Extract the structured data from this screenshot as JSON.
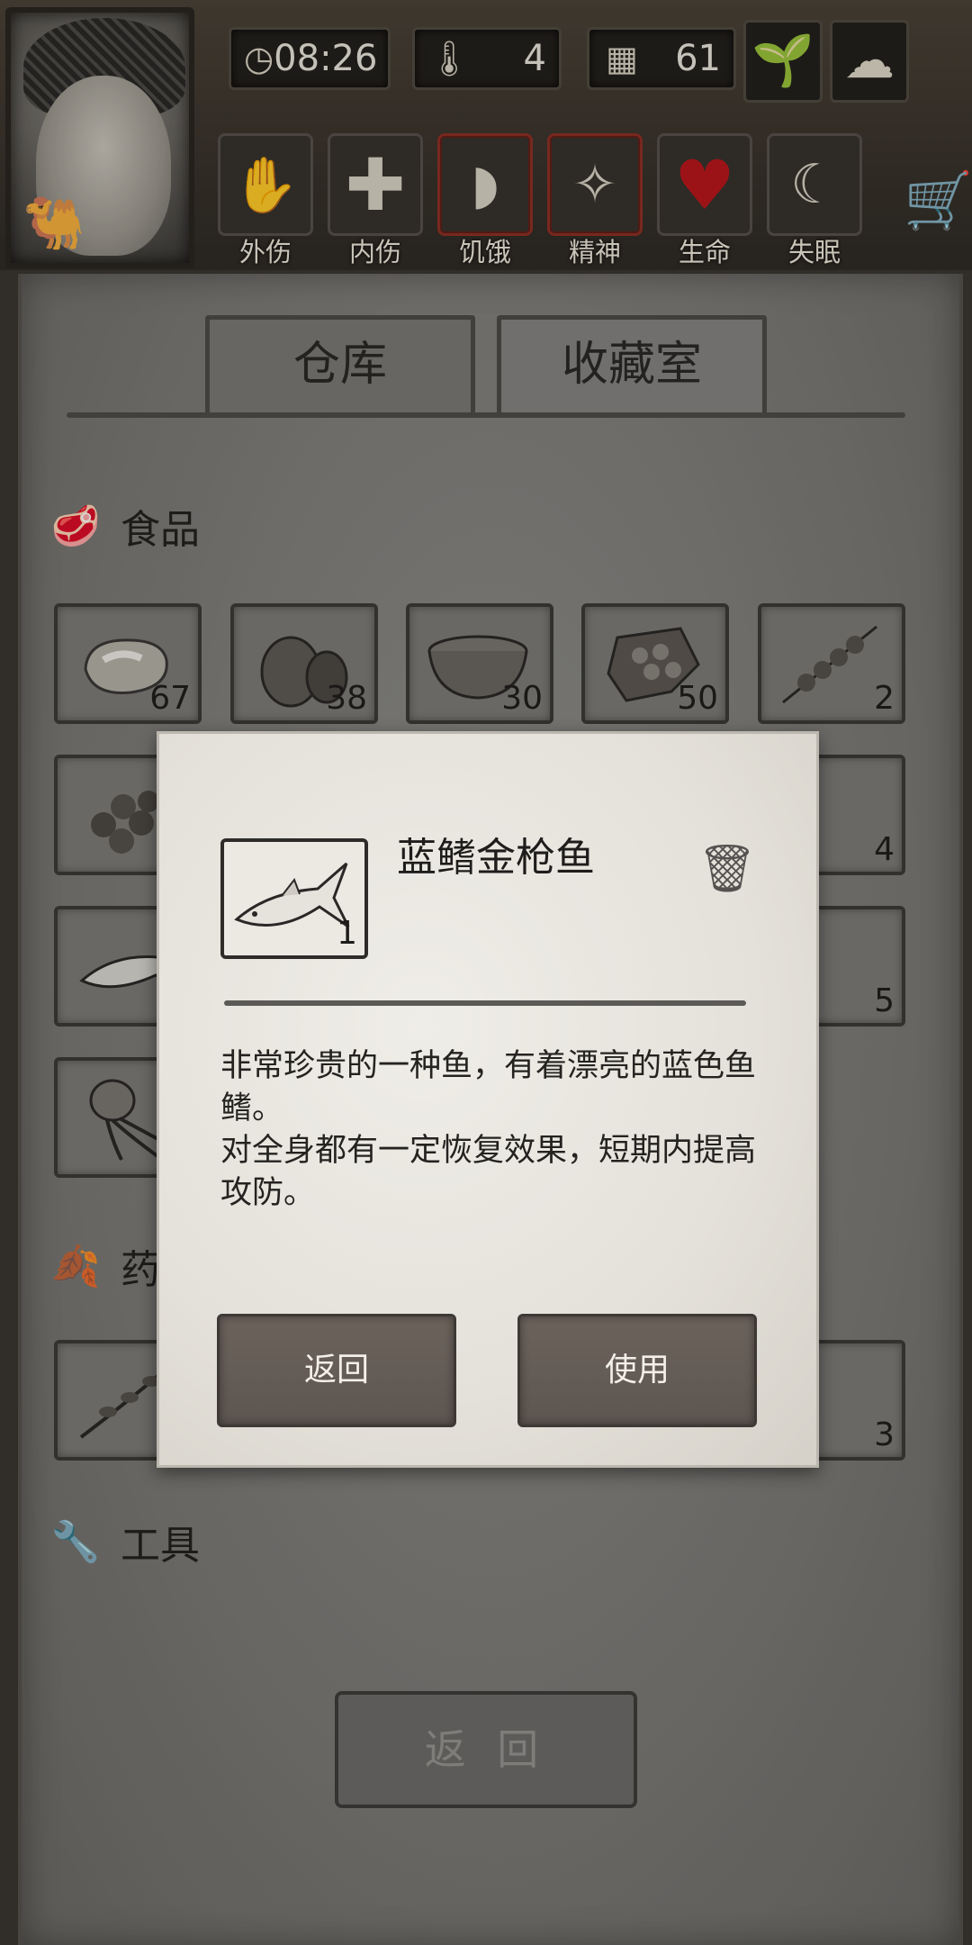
{
  "hud": {
    "time": "08:26",
    "temperature": "4",
    "day": "61",
    "status_icons": [
      {
        "label": "外伤",
        "icon": "bandaged-hand-icon"
      },
      {
        "label": "内伤",
        "icon": "cross-icon"
      },
      {
        "label": "饥饿",
        "icon": "stomach-icon"
      },
      {
        "label": "精神",
        "icon": "brain-sparkle-icon"
      },
      {
        "label": "生命",
        "icon": "heart-icon"
      },
      {
        "label": "失眠",
        "icon": "moon-star-icon"
      }
    ],
    "alert_color": "#8c3025",
    "heart_color": "#b8171c"
  },
  "tabs": {
    "warehouse": "仓库",
    "collection": "收藏室"
  },
  "sections": {
    "food": "食品",
    "medicine": "药",
    "tools": "工具"
  },
  "food_items": [
    {
      "name": "meat",
      "count": "67"
    },
    {
      "name": "coconut",
      "count": "38"
    },
    {
      "name": "stew-bowl",
      "count": "30"
    },
    {
      "name": "honeycomb",
      "count": "50"
    },
    {
      "name": "skewer",
      "count": "2"
    }
  ],
  "partial_counts": {
    "row2_right": "4",
    "row3_right": "5",
    "medicine_right": "3"
  },
  "back_button": "返 回",
  "modal": {
    "item_name": "蓝鳍金枪鱼",
    "item_count": "1",
    "description_line1": "非常珍贵的一种鱼，有着漂亮的蓝色鱼鳍。",
    "description_line2": "对全身都有一定恢复效果，短期内提高攻防。",
    "back_label": "返回",
    "use_label": "使用"
  }
}
